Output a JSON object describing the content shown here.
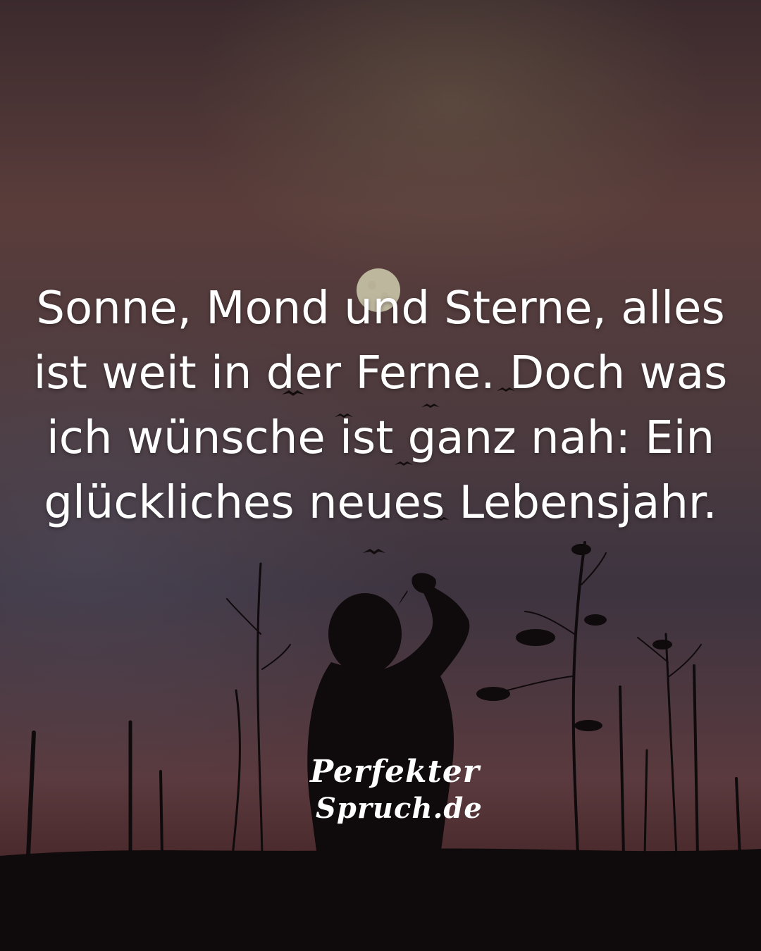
{
  "quote": {
    "lines": [
      "Sonne, Mond und Sterne, alles",
      "ist weit in der Ferne. Doch was",
      "ich wünsche ist ganz nah: Ein",
      "glückliches neues Lebensjahr."
    ]
  },
  "brand": {
    "line1": "Perfekter",
    "line2": "Spruch.de"
  },
  "colors": {
    "text": "#ffffff",
    "silhouette": "#0f0a0b",
    "moon": "#c9c4a8"
  }
}
